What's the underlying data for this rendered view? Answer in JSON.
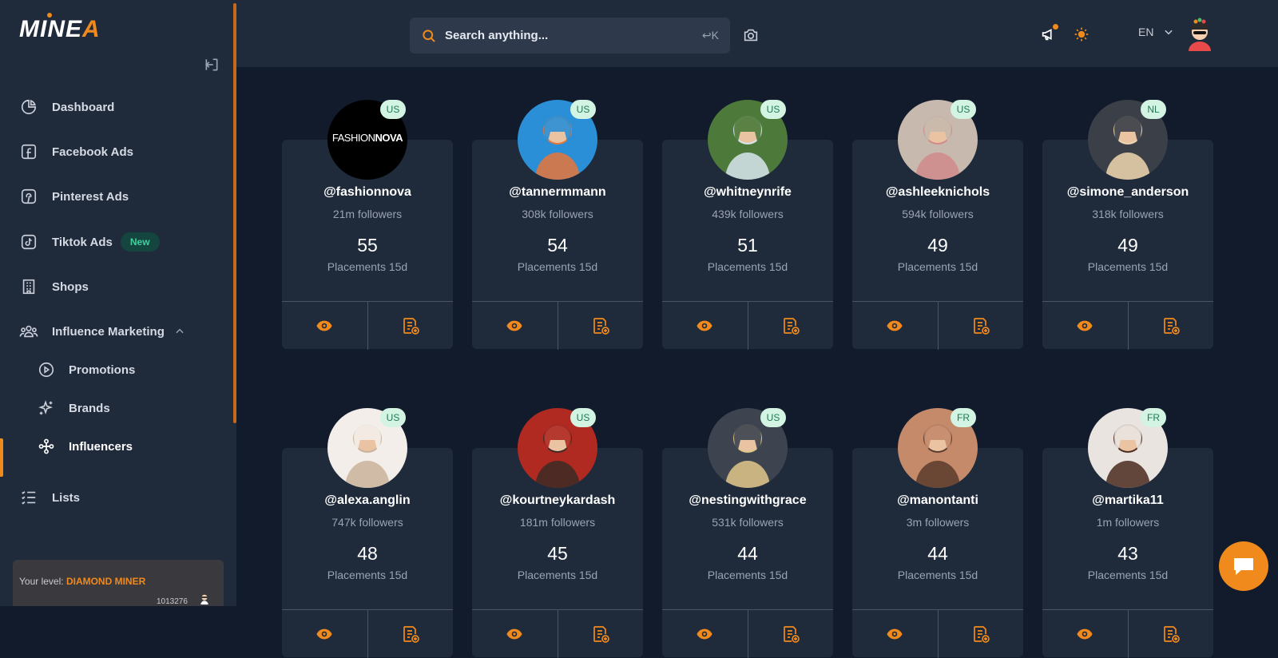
{
  "brand": {
    "name_main": "MINE",
    "name_accent": "A"
  },
  "sidebar": {
    "items": [
      {
        "id": "dashboard",
        "label": "Dashboard",
        "icon": "pie-chart-icon"
      },
      {
        "id": "facebook-ads",
        "label": "Facebook Ads",
        "icon": "facebook-icon"
      },
      {
        "id": "pinterest-ads",
        "label": "Pinterest Ads",
        "icon": "pinterest-icon"
      },
      {
        "id": "tiktok-ads",
        "label": "Tiktok Ads",
        "icon": "tiktok-icon",
        "badge": "New"
      },
      {
        "id": "shops",
        "label": "Shops",
        "icon": "building-icon"
      },
      {
        "id": "influence-marketing",
        "label": "Influence Marketing",
        "icon": "users-icon"
      },
      {
        "id": "promotions",
        "label": "Promotions",
        "icon": "play-circle-icon"
      },
      {
        "id": "brands",
        "label": "Brands",
        "icon": "sparkle-icon"
      },
      {
        "id": "influencers",
        "label": "Influencers",
        "icon": "network-icon",
        "active": true
      },
      {
        "id": "lists",
        "label": "Lists",
        "icon": "list-icon"
      }
    ],
    "level": {
      "label": "Your level:",
      "value": "DIAMOND MINER",
      "points": "1013276"
    }
  },
  "header": {
    "search": {
      "placeholder": "Search anything...",
      "shortcut": "↩K"
    },
    "language": "EN"
  },
  "placements_label": "Placements 15d",
  "influencers": [
    {
      "handle": "@fashionnova",
      "followers": "21m followers",
      "placements": "55",
      "country": "US"
    },
    {
      "handle": "@tannermmann",
      "followers": "308k followers",
      "placements": "54",
      "country": "US"
    },
    {
      "handle": "@whitneynrife",
      "followers": "439k followers",
      "placements": "51",
      "country": "US"
    },
    {
      "handle": "@ashleeknichols",
      "followers": "594k followers",
      "placements": "49",
      "country": "US"
    },
    {
      "handle": "@simone_anderson",
      "followers": "318k followers",
      "placements": "49",
      "country": "NL"
    },
    {
      "handle": "@alexa.anglin",
      "followers": "747k followers",
      "placements": "48",
      "country": "US"
    },
    {
      "handle": "@kourtneykardash",
      "followers": "181m followers",
      "placements": "45",
      "country": "US"
    },
    {
      "handle": "@nestingwithgrace",
      "followers": "531k followers",
      "placements": "44",
      "country": "US"
    },
    {
      "handle": "@manontanti",
      "followers": "3m followers",
      "placements": "44",
      "country": "FR"
    },
    {
      "handle": "@martika11",
      "followers": "1m followers",
      "placements": "43",
      "country": "FR"
    }
  ],
  "fashionnova_logo": {
    "part1": "FASHION",
    "part2": "NOVA"
  },
  "colors": {
    "accent": "#f08a1c",
    "sidebar": "#1f2a3b",
    "background": "#121b2b",
    "badge_green": "#d3f3e3"
  }
}
